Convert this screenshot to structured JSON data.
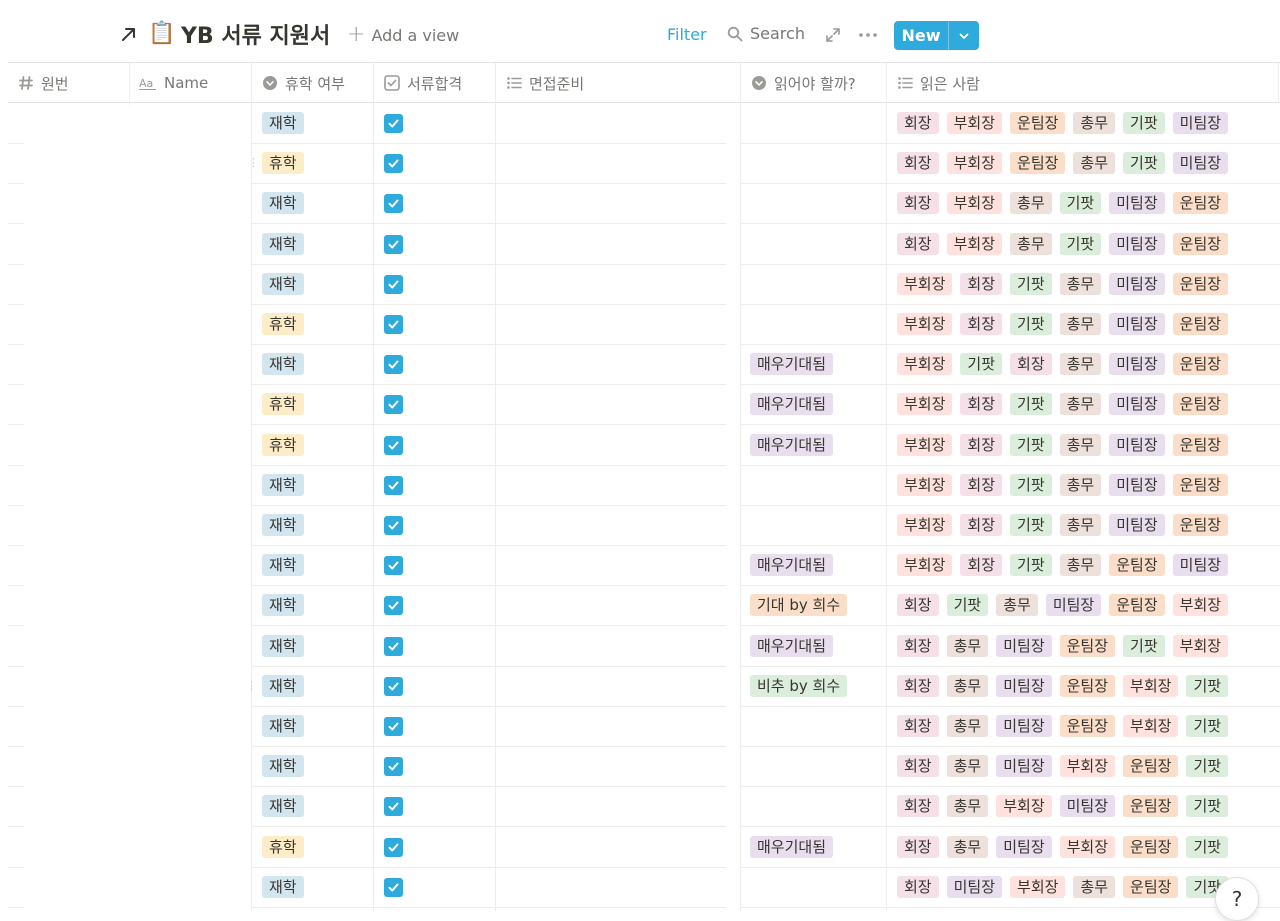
{
  "header": {
    "title_emoji": "📋",
    "title": "YB 서류 지원서",
    "add_view": "Add a view",
    "filter": "Filter",
    "search": "Search",
    "new_button": "New"
  },
  "columns": [
    {
      "label": "원번",
      "icon": "number-icon"
    },
    {
      "label": "Name",
      "icon": "text-icon"
    },
    {
      "label": "휴학 여부",
      "icon": "select-icon"
    },
    {
      "label": "서류합격",
      "icon": "checkbox-icon"
    },
    {
      "label": "면접준비",
      "icon": "list-icon"
    },
    {
      "label": "읽어야 할까?",
      "icon": "select-icon"
    },
    {
      "label": "읽은 사람",
      "icon": "list-icon"
    }
  ],
  "tag_colors": {
    "재학": "#d3e5ef",
    "휴학": "#fdecc8",
    "회장": "#f5e0e9",
    "부회장": "#ffe2dd",
    "운팀장": "#fadec9",
    "총무": "#eee0da",
    "기팟": "#dbeddb",
    "미팀장": "#e8deee",
    "매우기대됨": "#e8deee",
    "기대 by 희수": "#fadec9",
    "비추 by 희수": "#dbeddb"
  },
  "rows": [
    {
      "status": "재학",
      "passed": true,
      "read": "",
      "readers": [
        "회장",
        "부회장",
        "운팀장",
        "총무",
        "기팟",
        "미팀장"
      ]
    },
    {
      "status": "휴학",
      "passed": true,
      "read": "",
      "readers": [
        "회장",
        "부회장",
        "운팀장",
        "총무",
        "기팟",
        "미팀장"
      ]
    },
    {
      "status": "재학",
      "passed": true,
      "read": "",
      "readers": [
        "회장",
        "부회장",
        "총무",
        "기팟",
        "미팀장",
        "운팀장"
      ]
    },
    {
      "status": "재학",
      "passed": true,
      "read": "",
      "readers": [
        "회장",
        "부회장",
        "총무",
        "기팟",
        "미팀장",
        "운팀장"
      ]
    },
    {
      "status": "재학",
      "passed": true,
      "read": "",
      "readers": [
        "부회장",
        "회장",
        "기팟",
        "총무",
        "미팀장",
        "운팀장"
      ]
    },
    {
      "status": "휴학",
      "passed": true,
      "read": "",
      "readers": [
        "부회장",
        "회장",
        "기팟",
        "총무",
        "미팀장",
        "운팀장"
      ]
    },
    {
      "status": "재학",
      "passed": true,
      "read": "매우기대됨",
      "readers": [
        "부회장",
        "기팟",
        "회장",
        "총무",
        "미팀장",
        "운팀장"
      ]
    },
    {
      "status": "휴학",
      "passed": true,
      "read": "매우기대됨",
      "readers": [
        "부회장",
        "회장",
        "기팟",
        "총무",
        "미팀장",
        "운팀장"
      ]
    },
    {
      "status": "휴학",
      "passed": true,
      "read": "매우기대됨",
      "readers": [
        "부회장",
        "회장",
        "기팟",
        "총무",
        "미팀장",
        "운팀장"
      ]
    },
    {
      "status": "재학",
      "passed": true,
      "read": "",
      "readers": [
        "부회장",
        "회장",
        "기팟",
        "총무",
        "미팀장",
        "운팀장"
      ]
    },
    {
      "status": "재학",
      "passed": true,
      "read": "",
      "readers": [
        "부회장",
        "회장",
        "기팟",
        "총무",
        "미팀장",
        "운팀장"
      ]
    },
    {
      "status": "재학",
      "passed": true,
      "read": "매우기대됨",
      "readers": [
        "부회장",
        "회장",
        "기팟",
        "총무",
        "운팀장",
        "미팀장"
      ]
    },
    {
      "status": "재학",
      "passed": true,
      "read": "기대 by 희수",
      "readers": [
        "회장",
        "기팟",
        "총무",
        "미팀장",
        "운팀장",
        "부회장"
      ]
    },
    {
      "status": "재학",
      "passed": true,
      "read": "매우기대됨",
      "readers": [
        "회장",
        "총무",
        "미팀장",
        "운팀장",
        "기팟",
        "부회장"
      ]
    },
    {
      "status": "재학",
      "passed": true,
      "read": "비추 by 희수",
      "readers": [
        "회장",
        "총무",
        "미팀장",
        "운팀장",
        "부회장",
        "기팟"
      ]
    },
    {
      "status": "재학",
      "passed": true,
      "read": "",
      "readers": [
        "회장",
        "총무",
        "미팀장",
        "운팀장",
        "부회장",
        "기팟"
      ]
    },
    {
      "status": "재학",
      "passed": true,
      "read": "",
      "readers": [
        "회장",
        "총무",
        "미팀장",
        "부회장",
        "운팀장",
        "기팟"
      ]
    },
    {
      "status": "재학",
      "passed": true,
      "read": "",
      "readers": [
        "회장",
        "총무",
        "부회장",
        "미팀장",
        "운팀장",
        "기팟"
      ]
    },
    {
      "status": "휴학",
      "passed": true,
      "read": "매우기대됨",
      "readers": [
        "회장",
        "총무",
        "미팀장",
        "부회장",
        "운팀장",
        "기팟"
      ]
    },
    {
      "status": "재학",
      "passed": true,
      "read": "",
      "readers": [
        "회장",
        "미팀장",
        "부회장",
        "총무",
        "운팀장",
        "기팟"
      ]
    }
  ],
  "help_button": "?"
}
